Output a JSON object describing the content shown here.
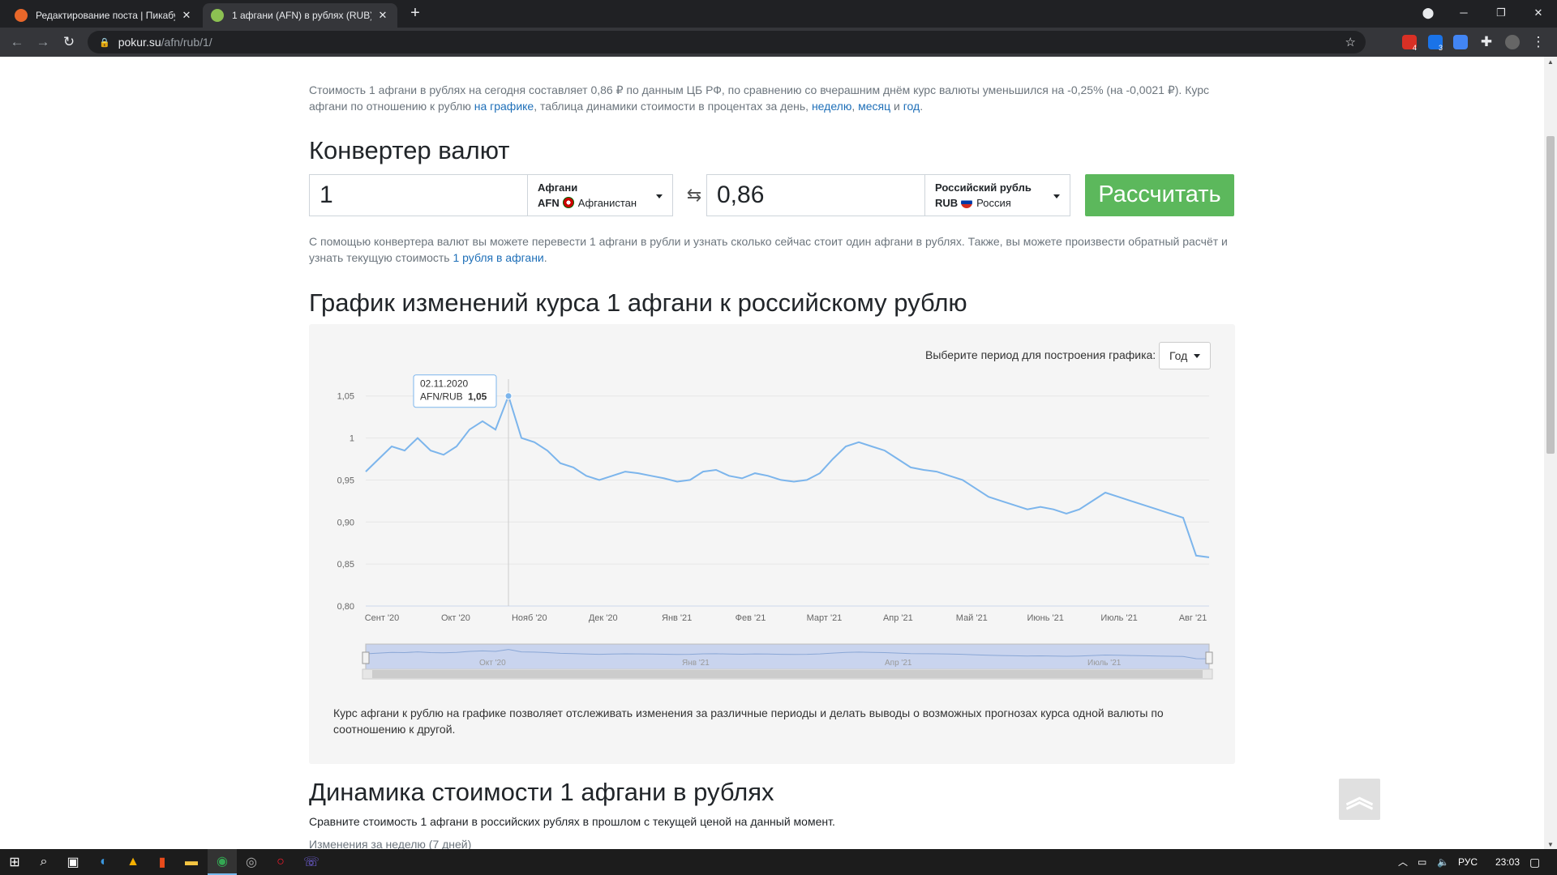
{
  "browser": {
    "tabs": [
      {
        "title": "Редактирование поста | Пикабу",
        "favicon_color": "#e8672a"
      },
      {
        "title": "1 афгани (AFN) в рублях (RUB) н",
        "favicon_color": "#8cc152"
      }
    ],
    "new_tab": "+",
    "url_host": "pokur.su",
    "url_path": "/afn/rub/1/",
    "ext_badges": [
      "4",
      "3"
    ]
  },
  "intro": {
    "part1": "Стоимость 1 афгани в рублях на сегодня составляет 0,86 ₽ по данным ЦБ РФ, по сравнению со вчерашним днём курс валюты уменьшился на -0,25% (на -0,0021 ₽). Курс афгани по отношению к рублю ",
    "link1": "на графике",
    "part2": ", таблица динамики стоимости в процентах за день, ",
    "link2": "неделю",
    "sep": ", ",
    "link3": "месяц",
    "and": " и ",
    "link4": "год",
    "end": "."
  },
  "converter": {
    "title": "Конвертер валют",
    "from_value": "1",
    "from_name": "Афгани",
    "from_code": "AFN",
    "from_country": "Афганистан",
    "swap": "⇆",
    "to_value": "0,86",
    "to_name": "Российский рубль",
    "to_code": "RUB",
    "to_country": "Россия",
    "button": "Рассчитать",
    "note1": "С помощью конвертера валют вы можете перевести 1 афгани в рубли и узнать сколько сейчас стоит один афгани в рублях. Также, вы можете произвести обратный расчёт и узнать текущую стоимость ",
    "note_link": "1 рубля в афгани",
    "note2": "."
  },
  "chart_section": {
    "title": "График изменений курса 1 афгани к российскому рублю",
    "period_label": "Выберите период для построения графика:",
    "period_value": "Год",
    "description": "Курс афгани к рублю на графике позволяет отслеживать изменения за различные периоды и делать выводы о возможных прогнозах курса одной валюты по соотношению к другой."
  },
  "chart_data": {
    "type": "line",
    "series": [
      {
        "values": [
          0.96,
          0.975,
          0.99,
          0.985,
          1.0,
          0.985,
          0.98,
          0.99,
          1.01,
          1.02,
          1.01,
          1.05,
          1.0,
          0.995,
          0.985,
          0.97,
          0.965,
          0.955,
          0.95,
          0.955,
          0.96,
          0.958,
          0.955,
          0.952,
          0.948,
          0.95,
          0.96,
          0.962,
          0.955,
          0.952,
          0.958,
          0.955,
          0.95,
          0.948,
          0.95,
          0.958,
          0.975,
          0.99,
          0.995,
          0.99,
          0.985,
          0.975,
          0.965,
          0.962,
          0.96,
          0.955,
          0.95,
          0.94,
          0.93,
          0.925,
          0.92,
          0.915,
          0.918,
          0.915,
          0.91,
          0.915,
          0.925,
          0.935,
          0.93,
          0.925,
          0.92,
          0.915,
          0.91,
          0.905,
          0.86,
          0.858
        ]
      }
    ],
    "x_tick_labels": [
      "Сент '20",
      "Окт '20",
      "Нояб '20",
      "Дек '20",
      "Янв '21",
      "Фев '21",
      "Март '21",
      "Апр '21",
      "Май '21",
      "Июнь '21",
      "Июль '21",
      "Авг '21"
    ],
    "y_tick_labels": [
      "1,05",
      "1",
      "0,95",
      "0,90",
      "0,85",
      "0,80"
    ],
    "ylim": [
      0.8,
      1.07
    ],
    "tooltip": {
      "date": "02.11.2020",
      "pair": "AFN/RUB",
      "value": "1,05"
    },
    "navigator_labels": [
      "Окт '20",
      "Янв '21",
      "Апр '21",
      "Июль '21"
    ],
    "grid": true
  },
  "dynamics": {
    "title": "Динамика стоимости 1 афгани в рублях",
    "subtitle": "Сравните стоимость 1 афгани в российских рублях в прошлом с текущей ценой на данный момент.",
    "week_label": "Изменения за неделю (7 дней)"
  },
  "taskbar": {
    "lang": "РУС",
    "time": "23:03"
  },
  "colors": {
    "accent": "#1e6fb8",
    "button": "#5cb85c",
    "line": "#7cb5ec"
  }
}
